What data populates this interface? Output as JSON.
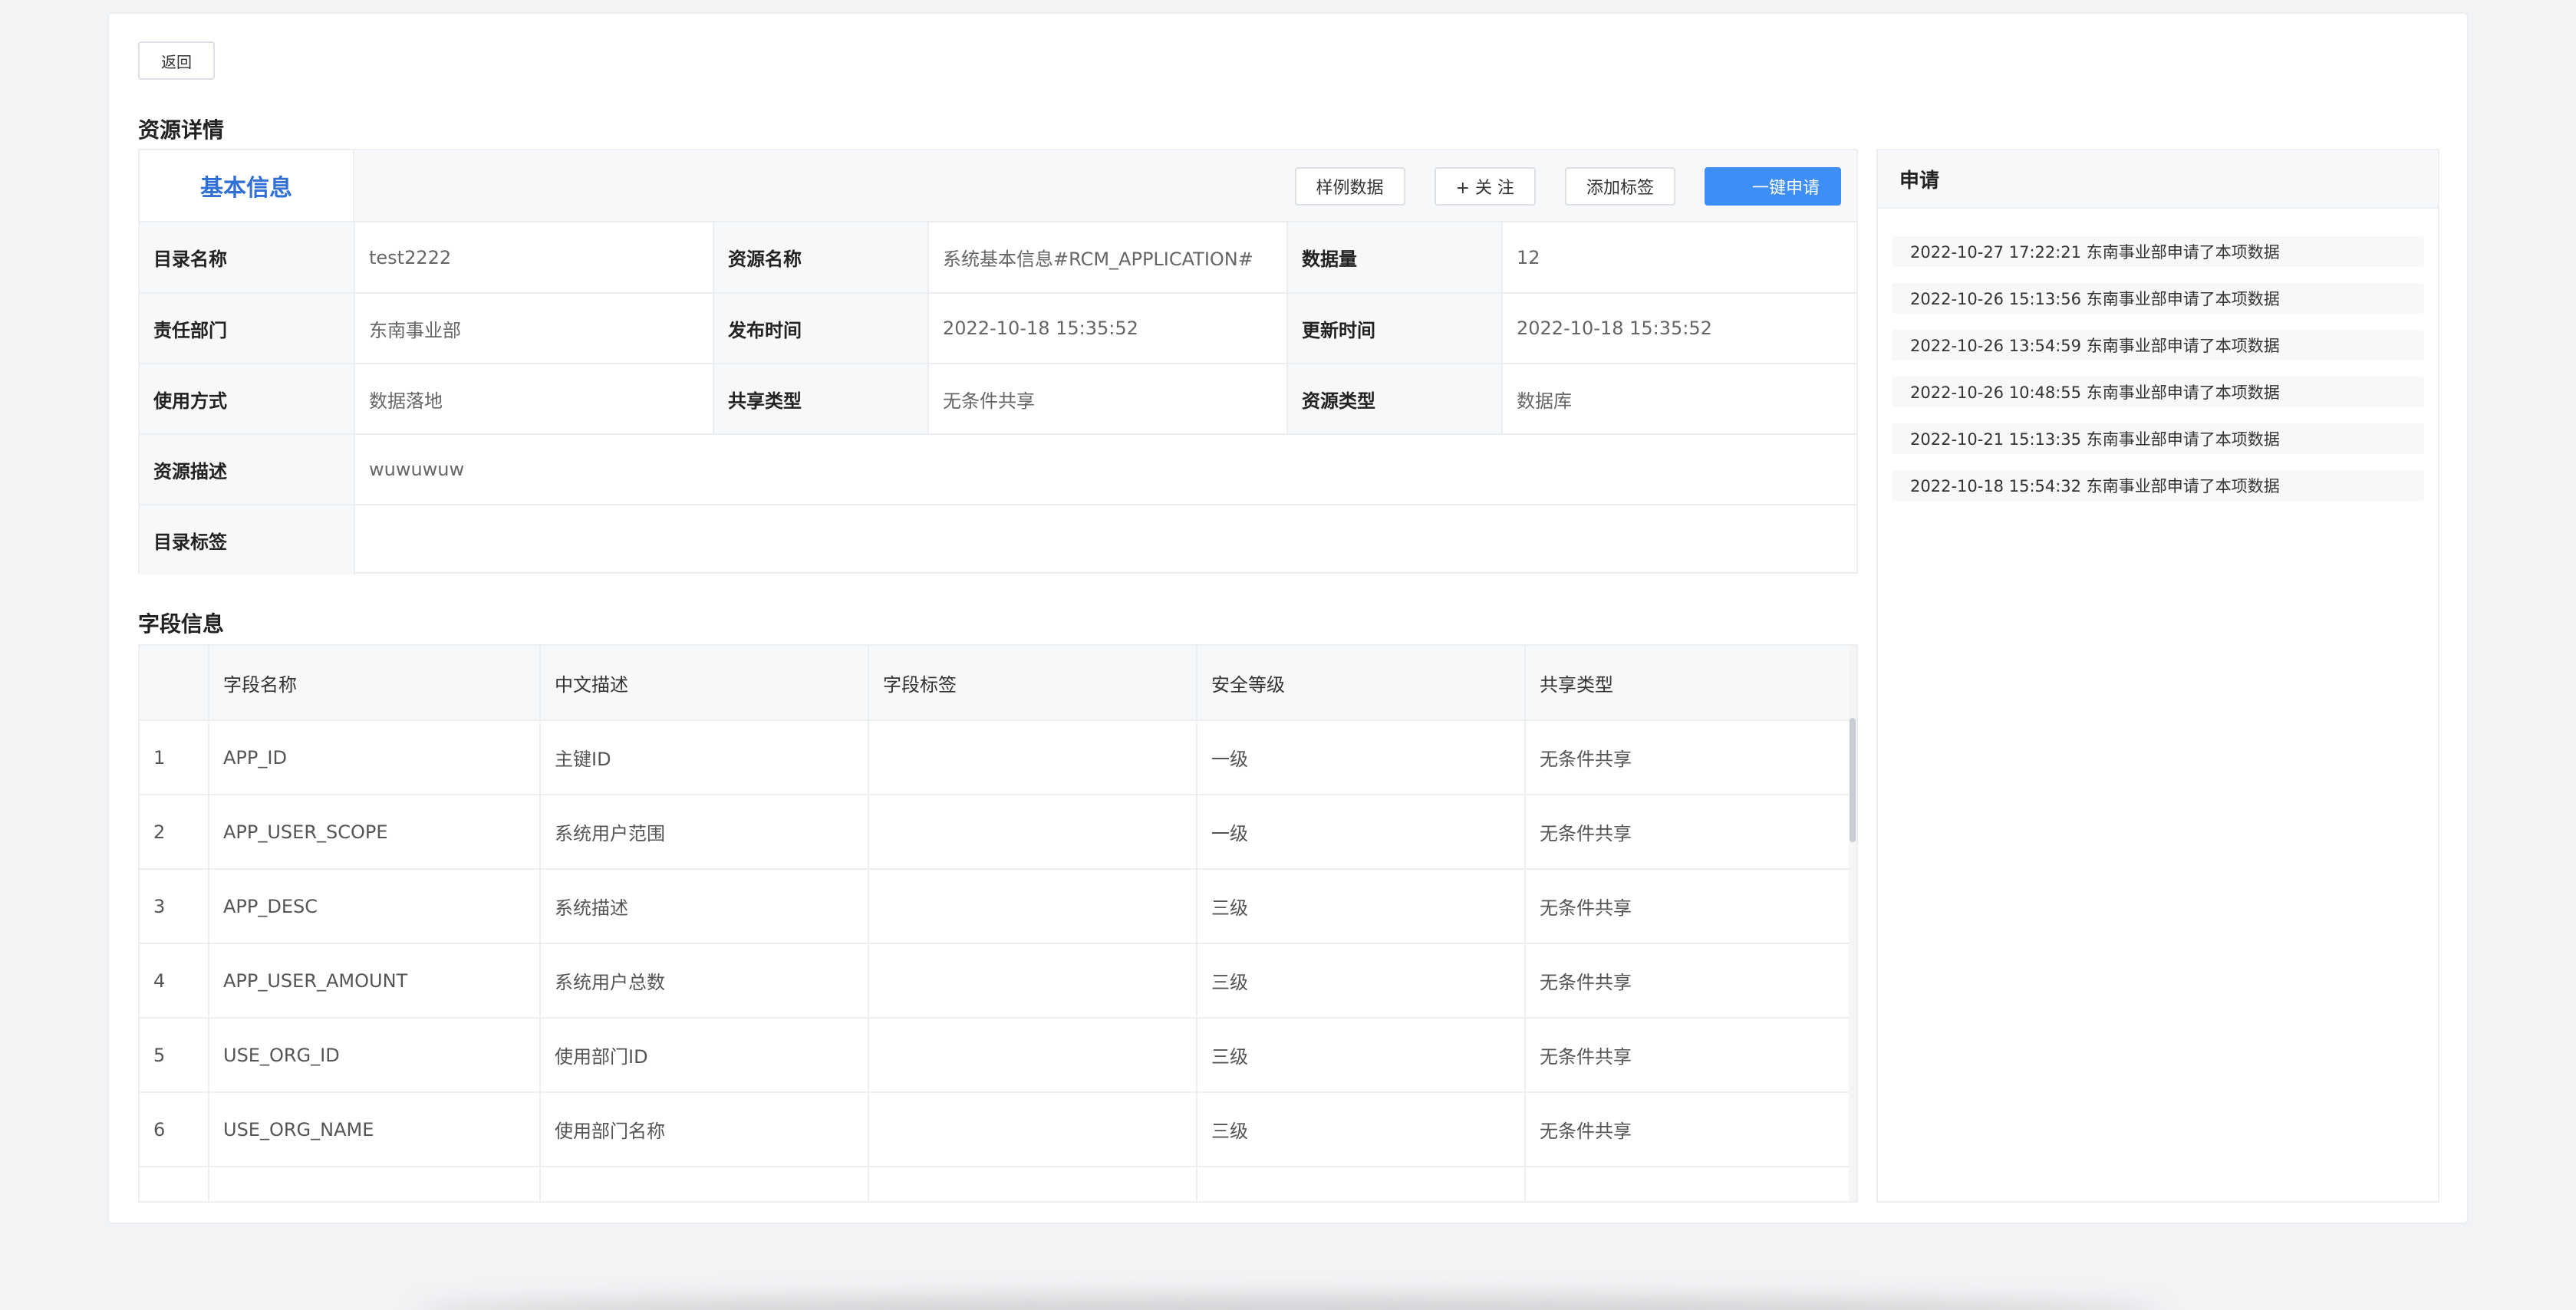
{
  "back_label": "返回",
  "page_title": "资源详情",
  "basic_info": {
    "tab_label": "基本信息",
    "actions": {
      "sample_data": "样例数据",
      "follow": "+ 关 注",
      "add_tag": "添加标签",
      "apply": "一键申请"
    },
    "rows": [
      [
        {
          "label": "目录名称",
          "value": "test2222"
        },
        {
          "label": "资源名称",
          "value": "系统基本信息#RCM_APPLICATION#"
        },
        {
          "label": "数据量",
          "value": "12"
        }
      ],
      [
        {
          "label": "责任部门",
          "value": "东南事业部"
        },
        {
          "label": "发布时间",
          "value": "2022-10-18 15:35:52"
        },
        {
          "label": "更新时间",
          "value": "2022-10-18 15:35:52"
        }
      ],
      [
        {
          "label": "使用方式",
          "value": "数据落地"
        },
        {
          "label": "共享类型",
          "value": "无条件共享"
        },
        {
          "label": "资源类型",
          "value": "数据库"
        }
      ]
    ],
    "description": {
      "label": "资源描述",
      "value": "wuwuwuw"
    },
    "catalog_tags": {
      "label": "目录标签",
      "value": ""
    }
  },
  "field_info": {
    "title": "字段信息",
    "columns": [
      "",
      "字段名称",
      "中文描述",
      "字段标签",
      "安全等级",
      "共享类型"
    ],
    "rows": [
      {
        "no": "1",
        "name": "APP_ID",
        "desc": "主键ID",
        "tag": "",
        "level": "一级",
        "share": "无条件共享"
      },
      {
        "no": "2",
        "name": "APP_USER_SCOPE",
        "desc": "系统用户范围",
        "tag": "",
        "level": "一级",
        "share": "无条件共享"
      },
      {
        "no": "3",
        "name": "APP_DESC",
        "desc": "系统描述",
        "tag": "",
        "level": "三级",
        "share": "无条件共享"
      },
      {
        "no": "4",
        "name": "APP_USER_AMOUNT",
        "desc": "系统用户总数",
        "tag": "",
        "level": "三级",
        "share": "无条件共享"
      },
      {
        "no": "5",
        "name": "USE_ORG_ID",
        "desc": "使用部门ID",
        "tag": "",
        "level": "三级",
        "share": "无条件共享"
      },
      {
        "no": "6",
        "name": "USE_ORG_NAME",
        "desc": "使用部门名称",
        "tag": "",
        "level": "三级",
        "share": "无条件共享"
      },
      {
        "no": "",
        "name": "",
        "desc": "",
        "tag": "",
        "level": "",
        "share": ""
      }
    ]
  },
  "apply_panel": {
    "title": "申请",
    "records": [
      "2022-10-27 17:22:21 东南事业部申请了本项数据",
      "2022-10-26 15:13:56 东南事业部申请了本项数据",
      "2022-10-26 13:54:59 东南事业部申请了本项数据",
      "2022-10-26 10:48:55 东南事业部申请了本项数据",
      "2022-10-21 15:13:35 东南事业部申请了本项数据",
      "2022-10-18 15:54:32 东南事业部申请了本项数据"
    ]
  },
  "colors": {
    "accent": "#3d8ef7",
    "tab_text": "#2f6fd6",
    "border": "#ebeef2",
    "header_bg": "#f7f8fa"
  }
}
